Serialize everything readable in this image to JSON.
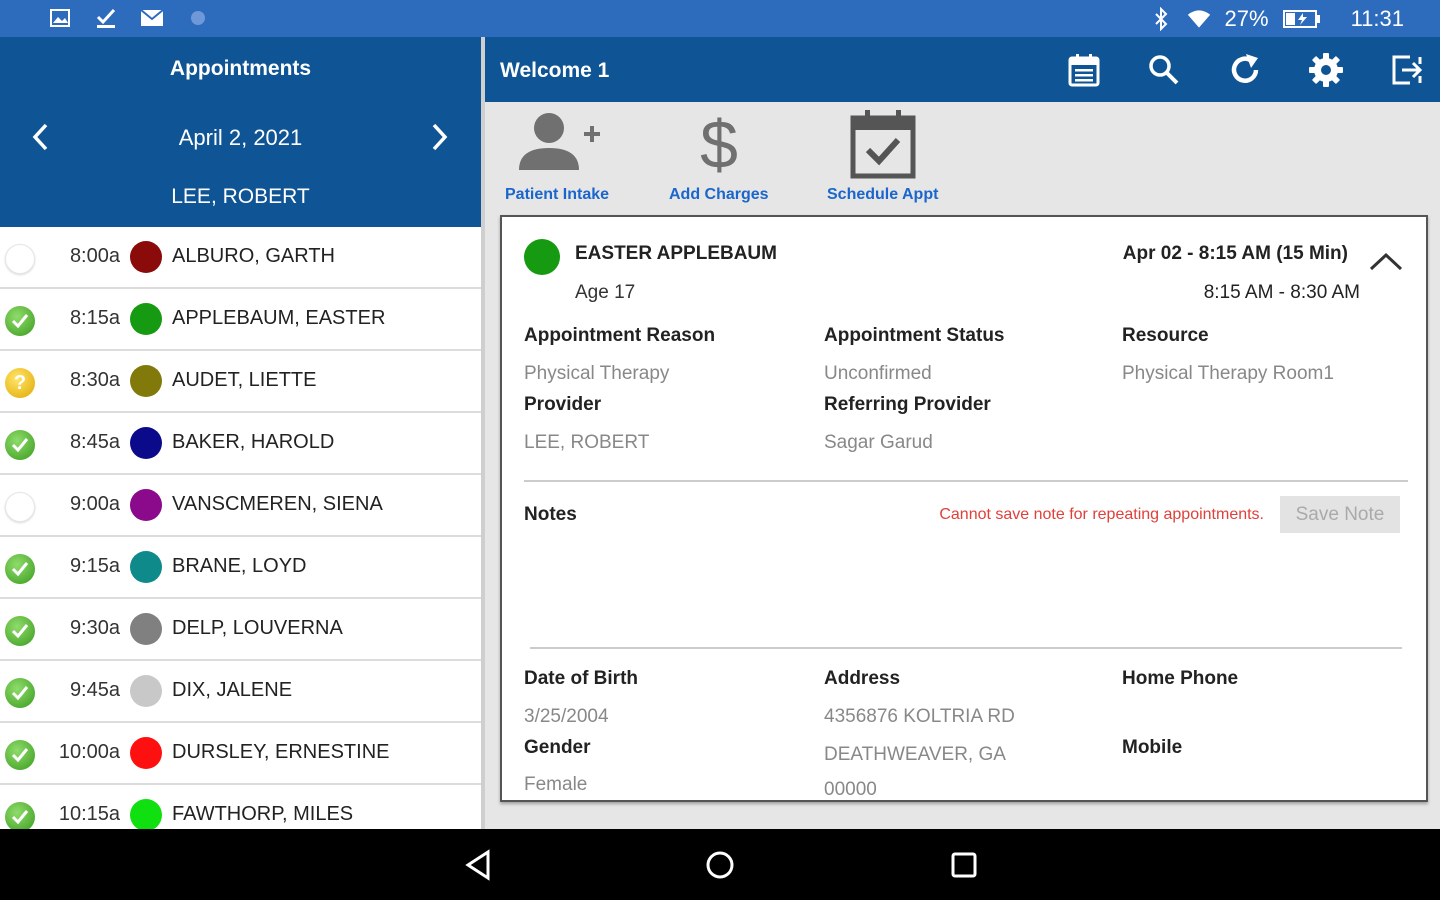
{
  "status_bar": {
    "battery": "27%",
    "time": "11:31"
  },
  "left": {
    "title": "Appointments",
    "date": "April 2, 2021",
    "provider": "LEE, ROBERT",
    "appointments": [
      {
        "status": "empty",
        "time": "8:00a",
        "color": "#8b0a0a",
        "name": "ALBURO, GARTH"
      },
      {
        "status": "ok",
        "time": "8:15a",
        "color": "#159a12",
        "name": "APPLEBAUM, EASTER"
      },
      {
        "status": "q",
        "time": "8:30a",
        "color": "#817a0a",
        "name": "AUDET, LIETTE"
      },
      {
        "status": "ok",
        "time": "8:45a",
        "color": "#0a0a8b",
        "name": "BAKER, HAROLD"
      },
      {
        "status": "empty",
        "time": "9:00a",
        "color": "#8a0a8b",
        "name": "VANSCMEREN, SIENA"
      },
      {
        "status": "ok",
        "time": "9:15a",
        "color": "#0f8a8a",
        "name": "BRANE, LOYD"
      },
      {
        "status": "ok",
        "time": "9:30a",
        "color": "#808080",
        "name": "DELP, LOUVERNA"
      },
      {
        "status": "ok",
        "time": "9:45a",
        "color": "#c8c8c8",
        "name": "DIX, JALENE"
      },
      {
        "status": "ok",
        "time": "10:00a",
        "color": "#ff1010",
        "name": "DURSLEY, ERNESTINE"
      },
      {
        "status": "ok",
        "time": "10:15a",
        "color": "#10e010",
        "name": "FAWTHORP, MILES"
      }
    ]
  },
  "header": {
    "welcome": "Welcome 1"
  },
  "toolbar": {
    "patient_intake": "Patient Intake",
    "add_charges": "Add Charges",
    "schedule_appt": "Schedule Appt"
  },
  "detail": {
    "patient_name": "EASTER APPLEBAUM",
    "age": "Age 17",
    "when": "Apr 02 - 8:15 AM (15 Min)",
    "range": "8:15 AM - 8:30 AM",
    "appt_reason_label": "Appointment Reason",
    "appt_reason": "Physical Therapy",
    "appt_status_label": "Appointment Status",
    "appt_status": "Unconfirmed",
    "resource_label": "Resource",
    "resource": "Physical Therapy Room1",
    "provider_label": "Provider",
    "provider": "LEE, ROBERT",
    "ref_provider_label": "Referring Provider",
    "ref_provider": "Sagar Garud",
    "notes_label": "Notes",
    "notes_warning": "Cannot save note for repeating appointments.",
    "save_note": "Save Note",
    "dob_label": "Date of Birth",
    "dob": "3/25/2004",
    "address_label": "Address",
    "address1": "4356876 KOLTRIA RD",
    "address2": "DEATHWEAVER, GA",
    "address3": "00000",
    "home_phone_label": "Home Phone",
    "gender_label": "Gender",
    "gender": "Female",
    "mobile_label": "Mobile"
  }
}
